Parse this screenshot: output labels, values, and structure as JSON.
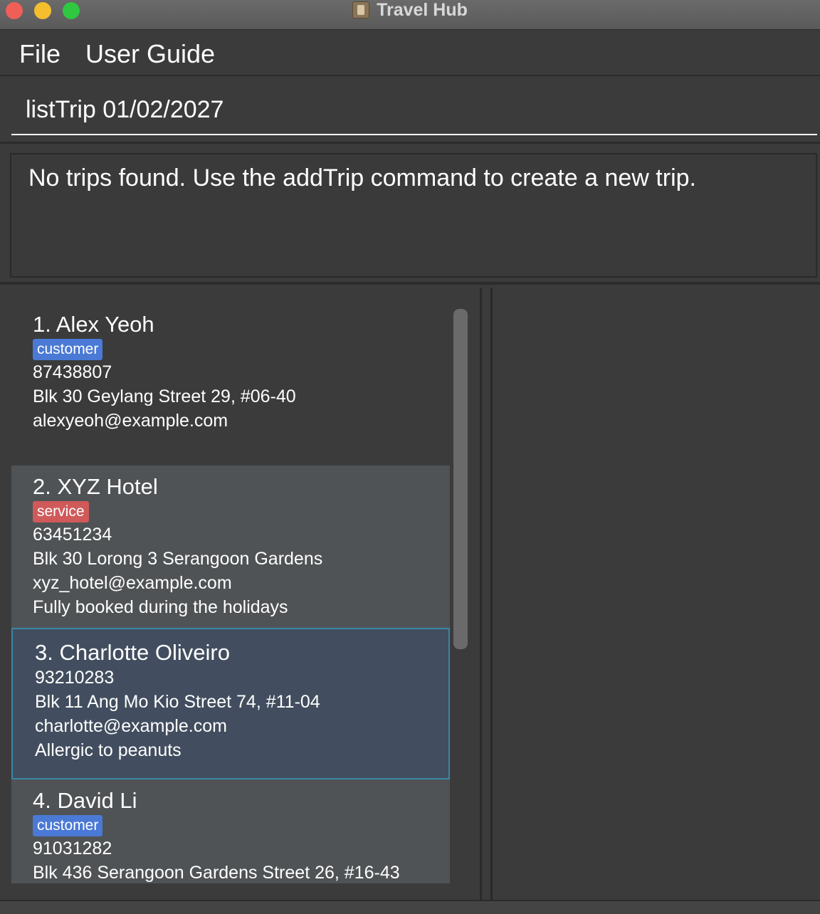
{
  "window": {
    "title": "Travel Hub"
  },
  "menu": {
    "items": [
      {
        "label": "File"
      },
      {
        "label": "User Guide"
      }
    ]
  },
  "command": {
    "value": "listTrip 01/02/2027"
  },
  "result": {
    "message": "No trips found. Use the addTrip command to create a new trip."
  },
  "contacts": [
    {
      "name": "1. Alex Yeoh",
      "tag": "customer",
      "phone": "87438807",
      "address": "Blk 30 Geylang Street 29, #06-40",
      "email": "alexyeoh@example.com",
      "note": ""
    },
    {
      "name": "2. XYZ Hotel",
      "tag": "service",
      "phone": "63451234",
      "address": "Blk 30 Lorong 3 Serangoon Gardens",
      "email": "xyz_hotel@example.com",
      "note": "Fully booked during the holidays"
    },
    {
      "name": "3. Charlotte Oliveiro",
      "tag": "",
      "phone": "93210283",
      "address": "Blk 11 Ang Mo Kio Street 74, #11-04",
      "email": "charlotte@example.com",
      "note": "Allergic to peanuts"
    },
    {
      "name": "4. David Li",
      "tag": "customer",
      "phone": "91031282",
      "address": "Blk 436 Serangoon Gardens Street 26, #16-43",
      "email": "",
      "note": ""
    }
  ],
  "colors": {
    "customer_tag": "#4a79d6",
    "service_tag": "#d05a5a",
    "selected_border": "#3a86a6"
  }
}
